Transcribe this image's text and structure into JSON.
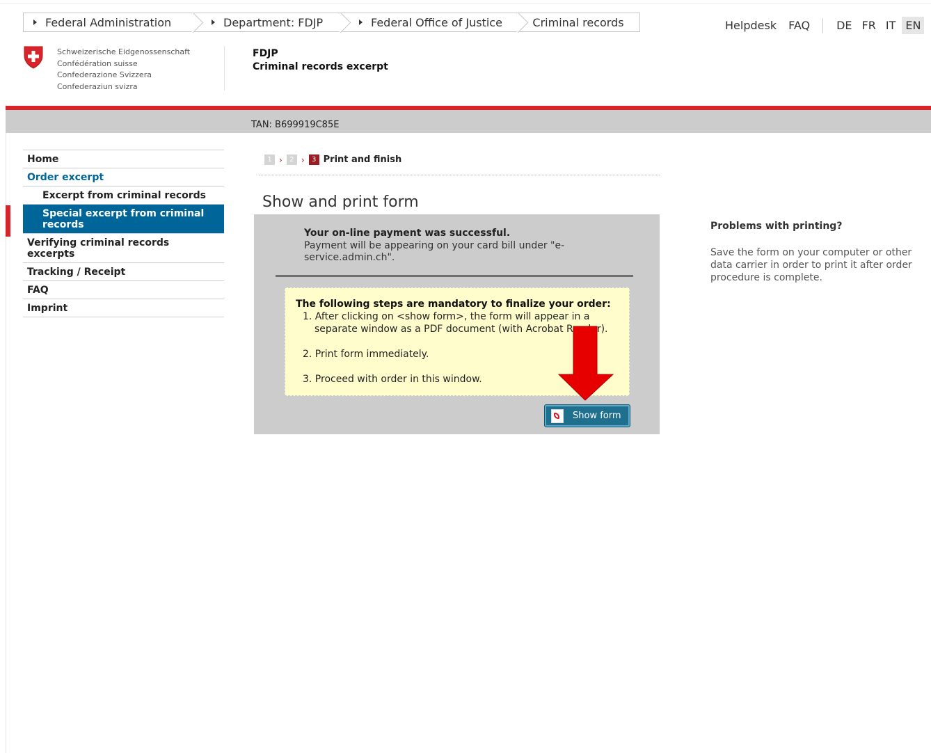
{
  "breadcrumb": {
    "items": [
      "Federal Administration",
      "Department: FDJP",
      "Federal Office of Justice",
      "Criminal records"
    ]
  },
  "topnav": {
    "helpdesk": "Helpdesk",
    "faq": "FAQ",
    "languages": [
      "DE",
      "FR",
      "IT",
      "EN"
    ],
    "active_language": "EN"
  },
  "header": {
    "confederation": [
      "Schweizerische Eidgenossenschaft",
      "Confédération suisse",
      "Confederazione Svizzera",
      "Confederaziun svizra"
    ],
    "department": "FDJP",
    "service": "Criminal records excerpt",
    "tan": "TAN: B699919C85E"
  },
  "nav": {
    "home": "Home",
    "order_excerpt": "Order excerpt",
    "excerpt_criminal": "Excerpt from criminal records",
    "special_excerpt": "Special excerpt from criminal records",
    "verifying": "Verifying criminal records excerpts",
    "tracking": "Tracking / Receipt",
    "faq": "FAQ",
    "imprint": "Imprint"
  },
  "steps": {
    "step1": "1",
    "step2": "2",
    "step3": "3",
    "current_label": "Print and finish"
  },
  "main": {
    "title": "Show and print form",
    "payment_title": "Your on-line payment was successful.",
    "payment_text": "Payment will be appearing on your card bill under \"e-service.admin.ch\".",
    "mandatory_title": "The following steps are mandatory to finalize your order:",
    "step1_a": "1. After clicking on <show form>, the form will appear in a",
    "step1_b": "separate window as a PDF document (with Acrobat Reader).",
    "step2": "2. Print form immediately.",
    "step3": "3. Proceed with order in this window.",
    "show_form_button": "Show form"
  },
  "sidebar_right": {
    "title": "Problems with printing?",
    "text": "Save the form on your computer or other data carrier in order to print it after order procedure is complete."
  },
  "colors": {
    "swiss_red": "#d8232a",
    "nav_blue": "#006699",
    "step_red": "#9c1c23",
    "yellow_box": "#fffdcc",
    "annotation_arrow": "#e60000"
  }
}
